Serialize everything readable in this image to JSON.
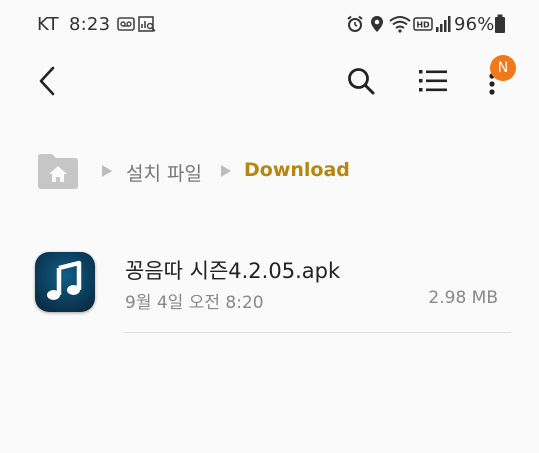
{
  "status_bar": {
    "carrier": "KT",
    "time": "8:23",
    "battery_percent": "96%",
    "left_icons": [
      "voicemail-icon",
      "data-usage-icon"
    ],
    "right_icons": [
      "alarm-icon",
      "location-icon",
      "wifi-icon",
      "hd-icon",
      "signal-icon",
      "battery-icon"
    ]
  },
  "app_bar": {
    "back_icon": "back-arrow-icon",
    "search_icon": "search-icon",
    "view_icon": "list-view-icon",
    "more_icon": "more-vert-icon",
    "badge_label": "N",
    "badge_color": "#f07a1a"
  },
  "breadcrumb": {
    "home_icon": "home-folder-icon",
    "items": [
      {
        "label": "설치 파일"
      },
      {
        "label": "Download"
      }
    ],
    "active_color": "#b8860b"
  },
  "files": [
    {
      "name": "꽁음따 시즌4.2.05.apk",
      "date": "9월 4일 오전 8:20",
      "size": "2.98 MB",
      "icon": "music-note-icon"
    }
  ]
}
